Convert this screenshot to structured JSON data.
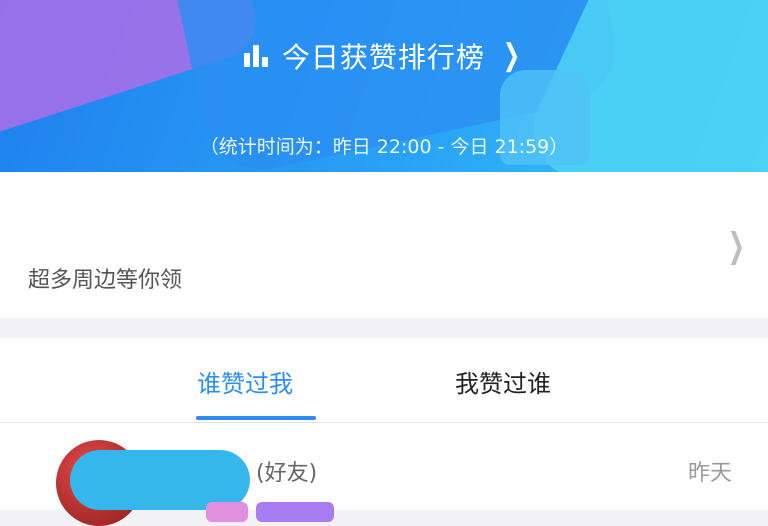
{
  "banner": {
    "title": "今日获赞排行榜",
    "stat_period": "（统计时间为：昨日 22:00 - 今日 21:59）",
    "colors": {
      "primary": "#1f7fee",
      "accent": "#39c6f7",
      "purple": "#a46fe8"
    },
    "icons": {
      "ranking": "bar-chart-icon",
      "more": "chevron-right-icon"
    }
  },
  "promo": {
    "subtitle": "超多周边等你领",
    "icons": {
      "more": "chevron-right-icon"
    }
  },
  "tabs": [
    {
      "label": "谁赞过我",
      "active": true
    },
    {
      "label": "我赞过谁",
      "active": false
    }
  ],
  "list": {
    "items": [
      {
        "relation": "(好友)",
        "time": "昨天"
      }
    ]
  },
  "colors": {
    "tab_active": "#2d8ef2",
    "redaction": "#35b7ec"
  }
}
